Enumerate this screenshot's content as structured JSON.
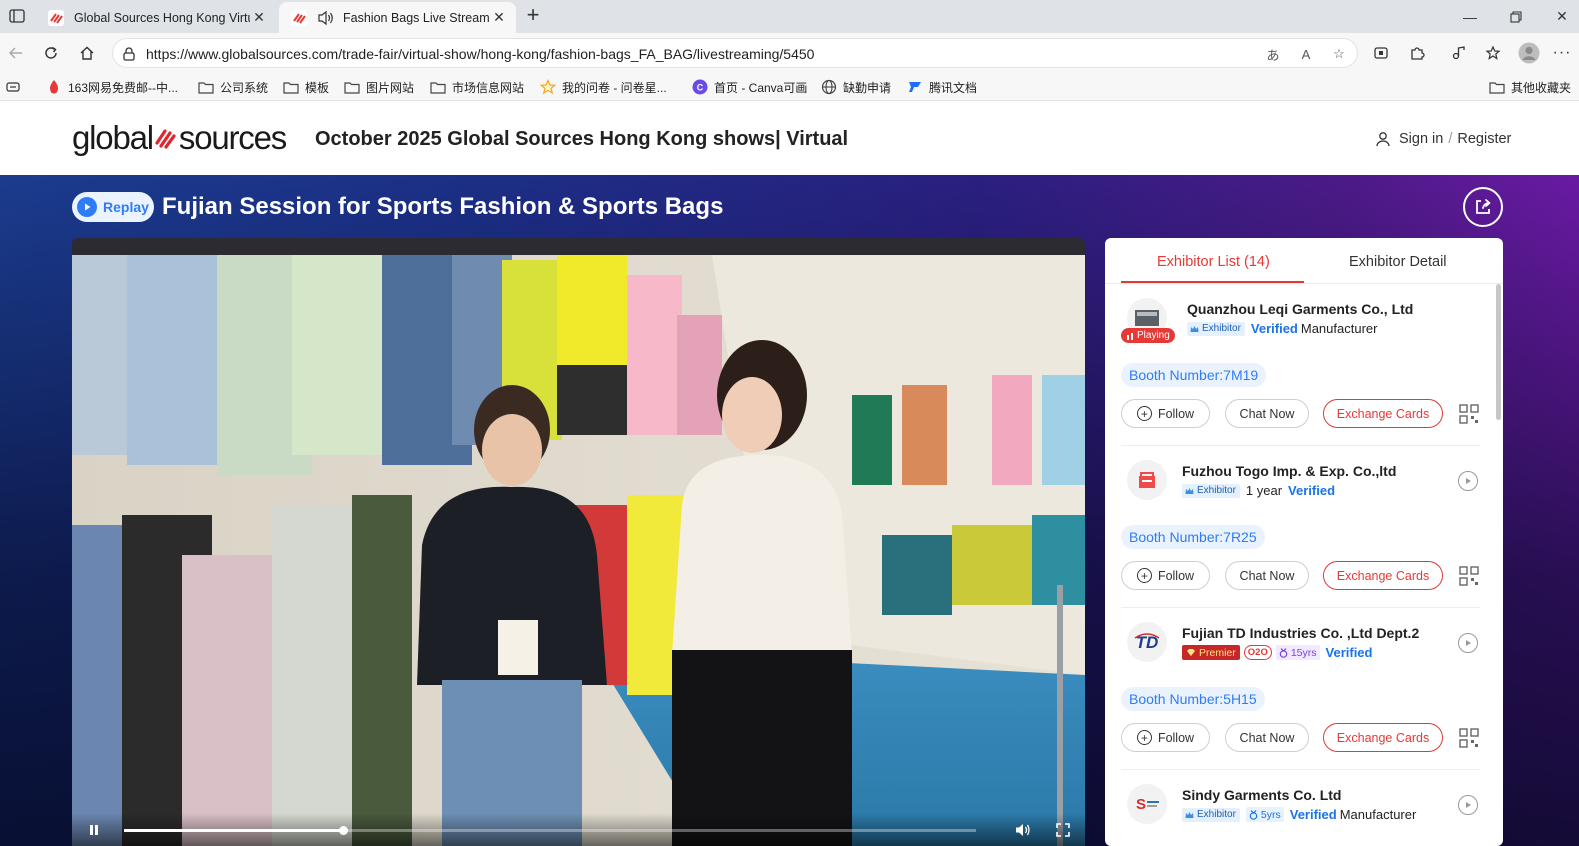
{
  "browser": {
    "tabs": [
      {
        "title": "Global Sources Hong Kong Virtual",
        "active": false
      },
      {
        "title": "Fashion Bags Live Streaming",
        "active": true
      }
    ],
    "url": "https://www.globalsources.com/trade-fair/virtual-show/hong-kong/fashion-bags_FA_BAG/livestreaming/5450",
    "bookmarks": [
      {
        "label": "163网易免费邮--中...",
        "icon": "163-mail-icon"
      },
      {
        "label": "公司系统",
        "icon": "folder-icon"
      },
      {
        "label": "模板",
        "icon": "folder-icon"
      },
      {
        "label": "图片网站",
        "icon": "folder-icon"
      },
      {
        "label": "市场信息网站",
        "icon": "folder-icon"
      },
      {
        "label": "我的问卷 - 问卷星...",
        "icon": "star-icon"
      },
      {
        "label": "首页 - Canva可画",
        "icon": "canva-icon"
      },
      {
        "label": "缺勤申请",
        "icon": "globe-icon"
      },
      {
        "label": "腾讯文档",
        "icon": "tencent-docs-icon"
      }
    ],
    "bookmarks_other": "其他收藏夹"
  },
  "site": {
    "logo_left": "global",
    "logo_right": "sources",
    "show_title": "October 2025 Global Sources Hong Kong shows| Virtual",
    "sign_in": "Sign in",
    "separator": "/",
    "register": "Register"
  },
  "session": {
    "status": "Replay",
    "title": "Fujian Session for Sports Fashion & Sports Bags"
  },
  "player": {
    "progress": 0.257
  },
  "panel": {
    "tabs": [
      "Exhibitor List (14)",
      "Exhibitor Detail"
    ],
    "exhibitors": [
      {
        "name": "Quanzhou Leqi Garments Co., Ltd",
        "badge": "Exhibitor",
        "verified": "Verified",
        "type": "Manufacturer",
        "playing": "Playing",
        "booth": "Booth Number:7M19"
      },
      {
        "name": "Fuzhou Togo Imp. & Exp. Co.,ltd",
        "badge": "Exhibitor",
        "years": "1 year",
        "verified": "Verified",
        "booth": "Booth Number:7R25"
      },
      {
        "name": "Fujian TD Industries Co. ,Ltd Dept.2",
        "badge": "Premier",
        "o2o": "O2O",
        "yrs": "15yrs",
        "verified": "Verified",
        "booth": "Booth Number:5H15"
      },
      {
        "name": "Sindy Garments Co. Ltd",
        "badge": "Exhibitor",
        "yrs": "5yrs",
        "verified": "Verified",
        "type": "Manufacturer"
      }
    ],
    "actions": {
      "follow": "Follow",
      "chat": "Chat Now",
      "exchange": "Exchange Cards"
    }
  },
  "colors": {
    "accent_red": "#e53935",
    "link_blue": "#1a73e8",
    "booth_blue": "#2f7df6"
  }
}
